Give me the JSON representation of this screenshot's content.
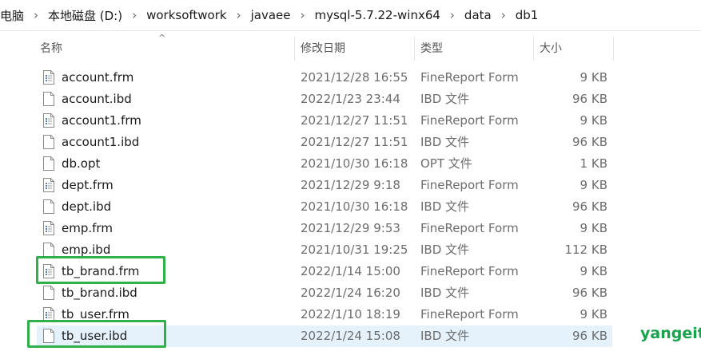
{
  "breadcrumb": [
    "电脑",
    "本地磁盘 (D:)",
    "worksoftwork",
    "javaee",
    "mysql-5.7.22-winx64",
    "data",
    "db1"
  ],
  "breadcrumb_separator": "›",
  "columns": {
    "name": "名称",
    "date": "修改日期",
    "type": "类型",
    "size": "大小",
    "sort_indicator": "^"
  },
  "files": [
    {
      "name": "account.frm",
      "date": "2021/12/28 16:55",
      "type": "FineReport Form",
      "size": "9 KB",
      "icon": "form-file-icon"
    },
    {
      "name": "account.ibd",
      "date": "2022/1/23 23:44",
      "type": "IBD 文件",
      "size": "96 KB",
      "icon": "blank-file-icon"
    },
    {
      "name": "account1.frm",
      "date": "2021/12/27 11:51",
      "type": "FineReport Form",
      "size": "9 KB",
      "icon": "form-file-icon"
    },
    {
      "name": "account1.ibd",
      "date": "2021/12/27 11:51",
      "type": "IBD 文件",
      "size": "96 KB",
      "icon": "blank-file-icon"
    },
    {
      "name": "db.opt",
      "date": "2021/10/30 16:18",
      "type": "OPT 文件",
      "size": "1 KB",
      "icon": "blank-file-icon"
    },
    {
      "name": "dept.frm",
      "date": "2021/12/29 9:18",
      "type": "FineReport Form",
      "size": "9 KB",
      "icon": "form-file-icon"
    },
    {
      "name": "dept.ibd",
      "date": "2021/10/30 16:18",
      "type": "IBD 文件",
      "size": "96 KB",
      "icon": "blank-file-icon"
    },
    {
      "name": "emp.frm",
      "date": "2021/12/29 9:53",
      "type": "FineReport Form",
      "size": "9 KB",
      "icon": "form-file-icon"
    },
    {
      "name": "emp.ibd",
      "date": "2021/10/31 19:25",
      "type": "IBD 文件",
      "size": "112 KB",
      "icon": "blank-file-icon"
    },
    {
      "name": "tb_brand.frm",
      "date": "2022/1/14 15:00",
      "type": "FineReport Form",
      "size": "9 KB",
      "icon": "form-file-icon"
    },
    {
      "name": "tb_brand.ibd",
      "date": "2022/1/24 16:20",
      "type": "IBD 文件",
      "size": "96 KB",
      "icon": "blank-file-icon"
    },
    {
      "name": "tb_user.frm",
      "date": "2022/1/10 18:19",
      "type": "FineReport Form",
      "size": "9 KB",
      "icon": "form-file-icon"
    },
    {
      "name": "tb_user.ibd",
      "date": "2022/1/24 15:08",
      "type": "IBD 文件",
      "size": "96 KB",
      "icon": "blank-file-icon"
    }
  ],
  "selected_file": "tb_user.ibd",
  "highlighted_files": [
    "tb_brand.frm",
    "tb_user.ibd"
  ],
  "highlight_color": "#2fb14a",
  "selection_color": "#e5f1fb",
  "watermark": "yangeit"
}
